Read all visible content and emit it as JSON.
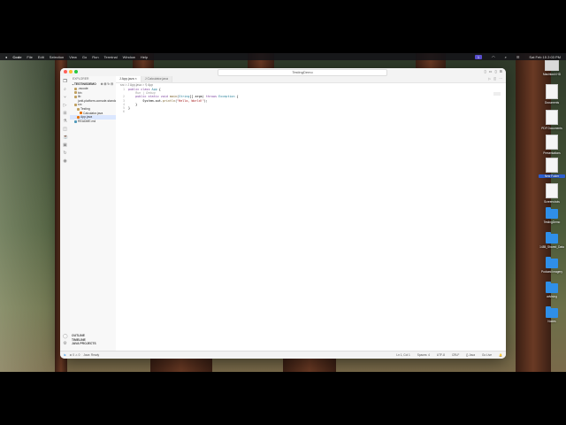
{
  "menubar": {
    "app": "Code",
    "items": [
      "File",
      "Edit",
      "Selection",
      "View",
      "Go",
      "Run",
      "Terminal",
      "Window",
      "Help"
    ],
    "badge": "1",
    "clock": "Sat Feb 15 2:03 PM"
  },
  "window": {
    "command_center": "TestingDemo",
    "explorer_label": "EXPLORER",
    "project": "TESTINGDEMO",
    "tree": [
      {
        "label": ".vscode",
        "depth": 1
      },
      {
        "label": "bin",
        "depth": 1
      },
      {
        "label": "lib",
        "depth": 1
      },
      {
        "label": "junit-platform-console-standalone",
        "depth": 2
      },
      {
        "label": "src",
        "depth": 1
      },
      {
        "label": "Testing",
        "depth": 2
      },
      {
        "label": "Calculator.java",
        "depth": 3
      },
      {
        "label": "App.java",
        "depth": 2,
        "selected": true
      },
      {
        "label": "README.md",
        "depth": 1
      }
    ],
    "bottom_sections": [
      "OUTLINE",
      "TIMELINE",
      "JAVA PROJECTS"
    ],
    "tabs": [
      {
        "label": "J App.java ×",
        "active": true
      },
      {
        "label": "J Calculator.java",
        "active": false
      }
    ],
    "breadcrumb": "src > J App.java > ⚲ App",
    "code": [
      {
        "n": "1",
        "html": "<span class='kw'>public class</span> <span class='ty'>App</span> {"
      },
      {
        "n": "",
        "html": "    <span class='hint'>Run | Debug</span>"
      },
      {
        "n": "2",
        "html": "    <span class='kw'>public static void</span> <span class='fn'>main</span>(<span class='ty'>String</span>[] args) <span class='kw'>throws</span> <span class='ty'>Exception</span> {"
      },
      {
        "n": "3",
        "html": "        System.out.<span class='fn'>println</span>(<span class='st'>\"Hello, World!\"</span>);"
      },
      {
        "n": "4",
        "html": "    }"
      },
      {
        "n": "5",
        "html": "}"
      },
      {
        "n": "6",
        "html": ""
      }
    ],
    "status_left": [
      "⊗ 0 ⚠ 0",
      "Java: Ready",
      "Ln 1, Col 1"
    ],
    "status_right": [
      "Spaces: 4",
      "UTF-8",
      "CRLF",
      "{} Java",
      "Go Live"
    ]
  },
  "desktop": [
    {
      "label": "Macintosh HD",
      "kind": "drive"
    },
    {
      "label": "Documents",
      "kind": "doc"
    },
    {
      "label": "PDF Documents",
      "kind": "doc"
    },
    {
      "label": "Presentations",
      "kind": "doc"
    },
    {
      "label": "New Folder",
      "kind": "doc",
      "selected": true
    },
    {
      "label": "Screenshots",
      "kind": "doc"
    },
    {
      "label": "TestingDemo",
      "kind": "folder"
    },
    {
      "label": "1485_Shared_Data",
      "kind": "folder"
    },
    {
      "label": "Podcast Imagery",
      "kind": "folder"
    },
    {
      "label": "advising",
      "kind": "folder"
    },
    {
      "label": "Nodes",
      "kind": "folder"
    }
  ],
  "colors": {
    "accent": "#2f8fe8",
    "close": "#ff5f57",
    "min": "#febc2e",
    "max": "#28c840"
  }
}
